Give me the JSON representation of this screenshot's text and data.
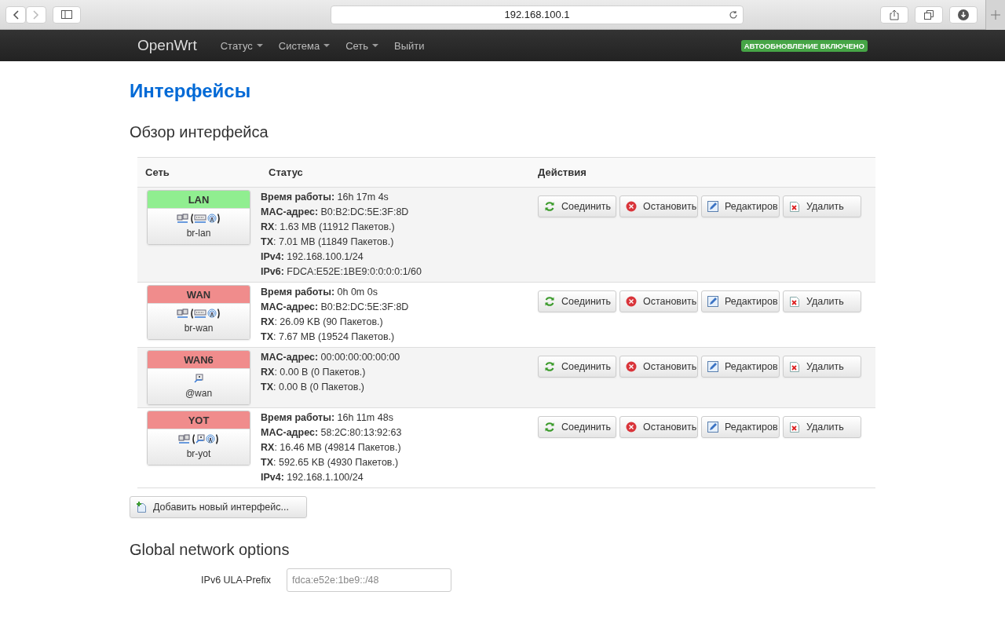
{
  "browser": {
    "url": "192.168.100.1"
  },
  "navbar": {
    "brand": "OpenWrt",
    "menus": [
      {
        "label": "Статус",
        "dropdown": true
      },
      {
        "label": "Система",
        "dropdown": true
      },
      {
        "label": "Сеть",
        "dropdown": true
      },
      {
        "label": "Выйти",
        "dropdown": false
      }
    ],
    "badge": "АВТООБНОВЛЕНИЕ ВКЛЮЧЕНО"
  },
  "page_title": "Интерфейсы",
  "section_title": "Обзор интерфейса",
  "table": {
    "columns": [
      "Сеть",
      "Статус",
      "Действия"
    ],
    "rows": [
      {
        "name": "LAN",
        "color": "#90ee90",
        "kind": "bridge",
        "device": "br-lan",
        "status": [
          "**Время работы:** 16h 17m 4s",
          "**MAC-адрес:** B0:B2:DC:5E:3F:8D",
          "**RX**: 1.63 MB (11912 Пакетов.)",
          "**TX**: 7.01 MB (11849 Пакетов.)",
          "**IPv4:** 192.168.100.1/24",
          "**IPv6:** FDCA:E52E:1BE9:0:0:0:0:1/60"
        ],
        "actions": [
          {
            "kind": "connect",
            "label": "Соединить"
          },
          {
            "kind": "stop",
            "label": "Остановить"
          },
          {
            "kind": "edit",
            "label": "Редактиров"
          },
          {
            "kind": "delete",
            "label": "Удалить"
          }
        ]
      },
      {
        "name": "WAN",
        "color": "#f08c8c",
        "kind": "bridge",
        "device": "br-wan",
        "status": [
          "**Время работы:** 0h 0m 0s",
          "**MAC-адрес:** B0:B2:DC:5E:3F:8D",
          "**RX**: 26.09 KB (90 Пакетов.)",
          "**TX**: 7.67 MB (19524 Пакетов.)"
        ],
        "actions": [
          {
            "kind": "connect",
            "label": "Соединить"
          },
          {
            "kind": "stop",
            "label": "Остановить"
          },
          {
            "kind": "edit",
            "label": "Редактиров"
          },
          {
            "kind": "delete",
            "label": "Удалить"
          }
        ]
      },
      {
        "name": "WAN6",
        "color": "#f08c8c",
        "kind": "alias",
        "device": "@wan",
        "status": [
          "**MAC-адрес:** 00:00:00:00:00:00",
          "**RX**: 0.00 B (0 Пакетов.)",
          "**TX**: 0.00 B (0 Пакетов.)"
        ],
        "actions": [
          {
            "kind": "connect",
            "label": "Соединить"
          },
          {
            "kind": "stop",
            "label": "Остановить"
          },
          {
            "kind": "edit",
            "label": "Редактиров"
          },
          {
            "kind": "delete",
            "label": "Удалить"
          }
        ]
      },
      {
        "name": "YOT",
        "color": "#f08c8c",
        "kind": "bridge",
        "device": "br-yot",
        "status": [
          "**Время работы:** 16h 11m 48s",
          "**MAC-адрес:** 58:2C:80:13:92:63",
          "**RX**: 16.46 MB (49814 Пакетов.)",
          "**TX**: 592.65 KB (4930 Пакетов.)",
          "**IPv4:** 192.168.1.100/24"
        ],
        "actions": [
          {
            "kind": "connect",
            "label": "Соединить"
          },
          {
            "kind": "stop",
            "label": "Остановить"
          },
          {
            "kind": "edit",
            "label": "Редактиров"
          },
          {
            "kind": "delete",
            "label": "Удалить"
          }
        ]
      }
    ]
  },
  "add_button": "Добавить новый интерфейс...",
  "global_options": {
    "title": "Global network options",
    "fields": [
      {
        "label": "IPv6 ULA-Prefix",
        "placeholder": "fdca:e52e:1be9::/48"
      }
    ]
  }
}
